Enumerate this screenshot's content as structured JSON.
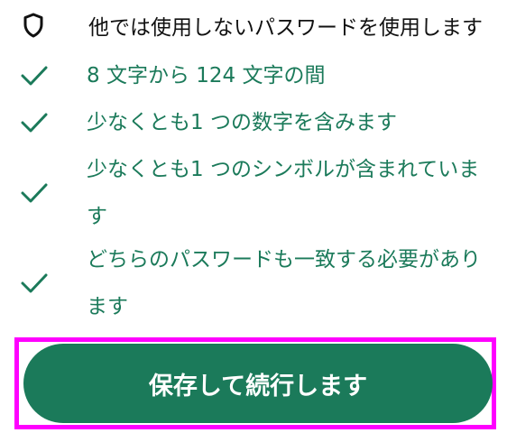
{
  "header": {
    "text": "他では使用しないパスワードを使用します",
    "icon": "shield-icon"
  },
  "requirements": [
    {
      "text": "8 文字から 124 文字の間",
      "icon": "check-icon"
    },
    {
      "text": "少なくとも1 つの数字を含みます",
      "icon": "check-icon"
    },
    {
      "text": "少なくとも1 つのシンボルが含まれていま\nす",
      "icon": "check-icon"
    },
    {
      "text": "どちらのパスワードも一致する必要があり\nます",
      "icon": "check-icon"
    }
  ],
  "actions": {
    "save_continue_label": "保存して続行します"
  },
  "colors": {
    "accent": "#1b7a5a",
    "text": "#111111",
    "highlight": "#ff00ff",
    "background": "#ffffff"
  }
}
